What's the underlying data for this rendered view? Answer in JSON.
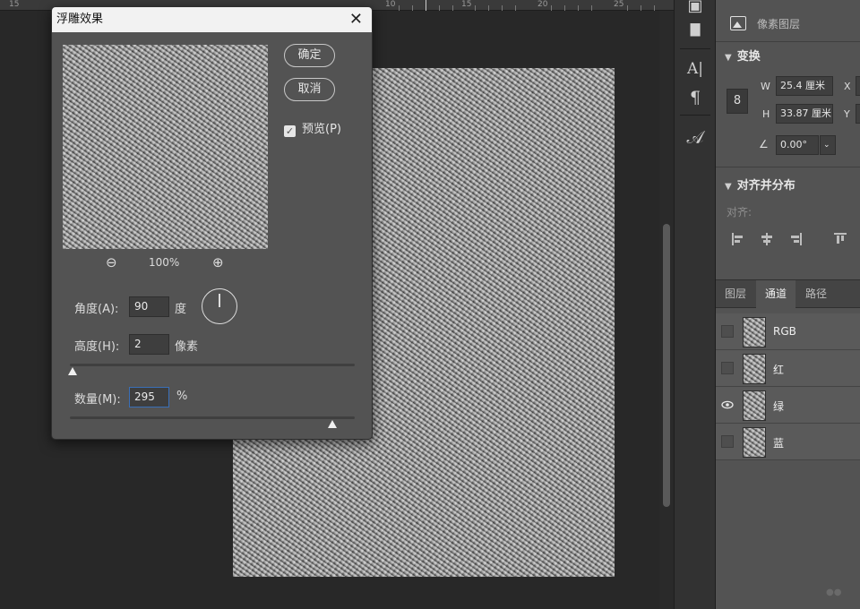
{
  "ruler": {
    "labels": [
      "15",
      "10",
      "15",
      "20",
      "25"
    ]
  },
  "tools": {
    "items": [
      {
        "name": "3d-icon",
        "glyph": "▣"
      },
      {
        "name": "comment-icon",
        "glyph": "▇"
      },
      {
        "name": "character-icon",
        "glyph": "A|"
      },
      {
        "name": "paragraph-icon",
        "glyph": "¶"
      },
      {
        "name": "glyph-icon",
        "glyph": "𝒜"
      }
    ]
  },
  "properties": {
    "layer_type": "像素图层",
    "transform": {
      "heading": "变换",
      "w_label": "W",
      "w_value": "25.4 厘米",
      "x_label": "X",
      "h_label": "H",
      "h_value": "33.87 厘米",
      "y_label": "Y",
      "angle_value": "0.00°"
    },
    "align": {
      "heading": "对齐并分布",
      "align_label": "对齐:"
    }
  },
  "panel_tabs": [
    {
      "label": "图层",
      "active": false
    },
    {
      "label": "通道",
      "active": true
    },
    {
      "label": "路径",
      "active": false
    }
  ],
  "channels": [
    {
      "name": "RGB",
      "visible": false
    },
    {
      "name": "红",
      "visible": false
    },
    {
      "name": "绿",
      "visible": true
    },
    {
      "name": "蓝",
      "visible": false
    }
  ],
  "dialog": {
    "title": "浮雕效果",
    "ok_label": "确定",
    "cancel_label": "取消",
    "preview_label": "预览(P)",
    "preview_checked": true,
    "zoom_level": "100%",
    "angle_label": "角度(A):",
    "angle_value": "90",
    "angle_unit": "度",
    "height_label": "高度(H):",
    "height_value": "2",
    "height_unit": "像素",
    "height_slider_fraction": 0.0,
    "amount_label": "数量(M):",
    "amount_value": "295",
    "amount_unit": "%",
    "amount_slider_fraction": 0.59
  },
  "colors": {
    "panel_bg": "#535353",
    "focus_blue": "#3a6fb7",
    "workspace": "#282828"
  }
}
